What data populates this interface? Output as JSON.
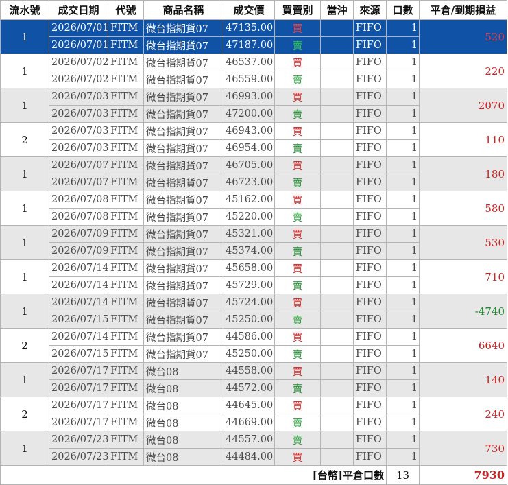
{
  "header": [
    "流水號",
    "成交日期",
    "代號",
    "商品名稱",
    "成交價",
    "買賣別",
    "當沖",
    "來源",
    "口數",
    "平倉/到期損益"
  ],
  "groups": [
    {
      "seq": "1",
      "pnl": "520",
      "selected": true,
      "rows": [
        {
          "date": "2026/07/01",
          "code": "FITM",
          "name": "微台指期貨07",
          "price": "47135.00",
          "side": "買",
          "daytrade": "",
          "source": "FIFO",
          "qty": "1"
        },
        {
          "date": "2026/07/01",
          "code": "FITM",
          "name": "微台指期貨07",
          "price": "47187.00",
          "side": "賣",
          "daytrade": "",
          "source": "FIFO",
          "qty": "1"
        }
      ]
    },
    {
      "seq": "1",
      "pnl": "220",
      "rows": [
        {
          "date": "2026/07/02",
          "code": "FITM",
          "name": "微台指期貨07",
          "price": "46537.00",
          "side": "買",
          "daytrade": "",
          "source": "FIFO",
          "qty": "1"
        },
        {
          "date": "2026/07/02",
          "code": "FITM",
          "name": "微台指期貨07",
          "price": "46559.00",
          "side": "賣",
          "daytrade": "",
          "source": "FIFO",
          "qty": "1"
        }
      ]
    },
    {
      "seq": "1",
      "pnl": "2070",
      "rows": [
        {
          "date": "2026/07/03",
          "code": "FITM",
          "name": "微台指期貨07",
          "price": "46993.00",
          "side": "買",
          "daytrade": "",
          "source": "FIFO",
          "qty": "1"
        },
        {
          "date": "2026/07/03",
          "code": "FITM",
          "name": "微台指期貨07",
          "price": "47200.00",
          "side": "賣",
          "daytrade": "",
          "source": "FIFO",
          "qty": "1"
        }
      ]
    },
    {
      "seq": "2",
      "pnl": "110",
      "rows": [
        {
          "date": "2026/07/03",
          "code": "FITM",
          "name": "微台指期貨07",
          "price": "46943.00",
          "side": "買",
          "daytrade": "",
          "source": "FIFO",
          "qty": "1"
        },
        {
          "date": "2026/07/03",
          "code": "FITM",
          "name": "微台指期貨07",
          "price": "46954.00",
          "side": "賣",
          "daytrade": "",
          "source": "FIFO",
          "qty": "1"
        }
      ]
    },
    {
      "seq": "1",
      "pnl": "180",
      "rows": [
        {
          "date": "2026/07/07",
          "code": "FITM",
          "name": "微台指期貨07",
          "price": "46705.00",
          "side": "買",
          "daytrade": "",
          "source": "FIFO",
          "qty": "1"
        },
        {
          "date": "2026/07/07",
          "code": "FITM",
          "name": "微台指期貨07",
          "price": "46723.00",
          "side": "賣",
          "daytrade": "",
          "source": "FIFO",
          "qty": "1"
        }
      ]
    },
    {
      "seq": "1",
      "pnl": "580",
      "rows": [
        {
          "date": "2026/07/08",
          "code": "FITM",
          "name": "微台指期貨07",
          "price": "45162.00",
          "side": "買",
          "daytrade": "",
          "source": "FIFO",
          "qty": "1"
        },
        {
          "date": "2026/07/08",
          "code": "FITM",
          "name": "微台指期貨07",
          "price": "45220.00",
          "side": "賣",
          "daytrade": "",
          "source": "FIFO",
          "qty": "1"
        }
      ]
    },
    {
      "seq": "1",
      "pnl": "530",
      "rows": [
        {
          "date": "2026/07/09",
          "code": "FITM",
          "name": "微台指期貨07",
          "price": "45321.00",
          "side": "買",
          "daytrade": "",
          "source": "FIFO",
          "qty": "1"
        },
        {
          "date": "2026/07/09",
          "code": "FITM",
          "name": "微台指期貨07",
          "price": "45374.00",
          "side": "賣",
          "daytrade": "",
          "source": "FIFO",
          "qty": "1"
        }
      ]
    },
    {
      "seq": "1",
      "pnl": "710",
      "rows": [
        {
          "date": "2026/07/14",
          "code": "FITM",
          "name": "微台指期貨07",
          "price": "45658.00",
          "side": "買",
          "daytrade": "",
          "source": "FIFO",
          "qty": "1"
        },
        {
          "date": "2026/07/14",
          "code": "FITM",
          "name": "微台指期貨07",
          "price": "45729.00",
          "side": "賣",
          "daytrade": "",
          "source": "FIFO",
          "qty": "1"
        }
      ]
    },
    {
      "seq": "1",
      "pnl": "-4740",
      "rows": [
        {
          "date": "2026/07/14",
          "code": "FITM",
          "name": "微台指期貨07",
          "price": "45724.00",
          "side": "買",
          "daytrade": "",
          "source": "FIFO",
          "qty": "1"
        },
        {
          "date": "2026/07/15",
          "code": "FITM",
          "name": "微台指期貨07",
          "price": "45250.00",
          "side": "賣",
          "daytrade": "",
          "source": "FIFO",
          "qty": "1"
        }
      ]
    },
    {
      "seq": "2",
      "pnl": "6640",
      "rows": [
        {
          "date": "2026/07/14",
          "code": "FITM",
          "name": "微台指期貨07",
          "price": "44586.00",
          "side": "買",
          "daytrade": "",
          "source": "FIFO",
          "qty": "1"
        },
        {
          "date": "2026/07/15",
          "code": "FITM",
          "name": "微台指期貨07",
          "price": "45250.00",
          "side": "賣",
          "daytrade": "",
          "source": "FIFO",
          "qty": "1"
        }
      ]
    },
    {
      "seq": "1",
      "pnl": "140",
      "rows": [
        {
          "date": "2026/07/17",
          "code": "FITM",
          "name": "微台08",
          "price": "44558.00",
          "side": "買",
          "daytrade": "",
          "source": "FIFO",
          "qty": "1"
        },
        {
          "date": "2026/07/17",
          "code": "FITM",
          "name": "微台08",
          "price": "44572.00",
          "side": "賣",
          "daytrade": "",
          "source": "FIFO",
          "qty": "1"
        }
      ]
    },
    {
      "seq": "2",
      "pnl": "240",
      "rows": [
        {
          "date": "2026/07/17",
          "code": "FITM",
          "name": "微台08",
          "price": "44645.00",
          "side": "買",
          "daytrade": "",
          "source": "FIFO",
          "qty": "1"
        },
        {
          "date": "2026/07/17",
          "code": "FITM",
          "name": "微台08",
          "price": "44669.00",
          "side": "賣",
          "daytrade": "",
          "source": "FIFO",
          "qty": "1"
        }
      ]
    },
    {
      "seq": "1",
      "pnl": "730",
      "rows": [
        {
          "date": "2026/07/23",
          "code": "FITM",
          "name": "微台08",
          "price": "44557.00",
          "side": "賣",
          "daytrade": "",
          "source": "FIFO",
          "qty": "1"
        },
        {
          "date": "2026/07/23",
          "code": "FITM",
          "name": "微台08",
          "price": "44484.00",
          "side": "買",
          "daytrade": "",
          "source": "FIFO",
          "qty": "1"
        }
      ]
    }
  ],
  "footer": {
    "label": "[台幣]平倉口數",
    "total_qty": "13",
    "total_pnl": "7930"
  },
  "colors": {
    "selected_bg": "#1053a6",
    "alt_row_bg": "#e7e7e7",
    "buy": "#d92020",
    "sell": "#1b8a2e",
    "profit": "#cc2222",
    "loss": "#1b8a2e"
  }
}
